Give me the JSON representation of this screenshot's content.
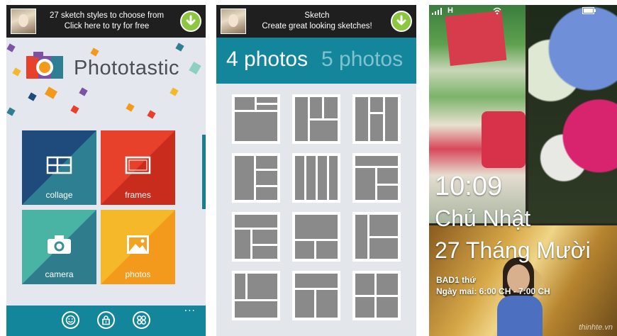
{
  "panel1": {
    "ad": {
      "line1": "27 sketch styles to choose from",
      "line2": "Click here to try for free",
      "icon": "download-icon"
    },
    "brand": "Phototastic",
    "tiles": [
      {
        "label": "collage",
        "icon": "collage-icon"
      },
      {
        "label": "frames",
        "icon": "frame-icon"
      },
      {
        "label": "camera",
        "icon": "camera-icon"
      },
      {
        "label": "photos",
        "icon": "photos-icon"
      }
    ],
    "appbar": {
      "buttons": [
        "smiley-icon",
        "lock-icon",
        "apps-icon"
      ],
      "more": "..."
    }
  },
  "panel2": {
    "ad": {
      "line1": "Sketch",
      "line2": "Create great looking sketches!",
      "icon": "download-icon"
    },
    "tabs": [
      "4 photos",
      "5 photos"
    ],
    "layouts_count": 12
  },
  "panel3": {
    "status": {
      "signal": "signal-icon",
      "network": "H",
      "wifi": "wifi-icon",
      "battery": "battery-icon"
    },
    "time": "10:09",
    "day": "Chủ Nhật",
    "date": "27 Tháng Mười",
    "event_title": "BAD1 thứ",
    "event_time": "Ngày mai: 6:00 CH - 7:00 CH",
    "watermark": "thinhte.vn"
  },
  "colors": {
    "teal": "#14869c",
    "ad_bg": "#1f1f1f",
    "download": "#8dc63f",
    "collage": [
      "#1f4b7c",
      "#2e7f92"
    ],
    "frames": [
      "#e8412b",
      "#c72c1c"
    ],
    "camera": [
      "#3fa79b",
      "#2f7d8c"
    ],
    "photos": [
      "#f39a1d",
      "#f5b82a"
    ]
  }
}
